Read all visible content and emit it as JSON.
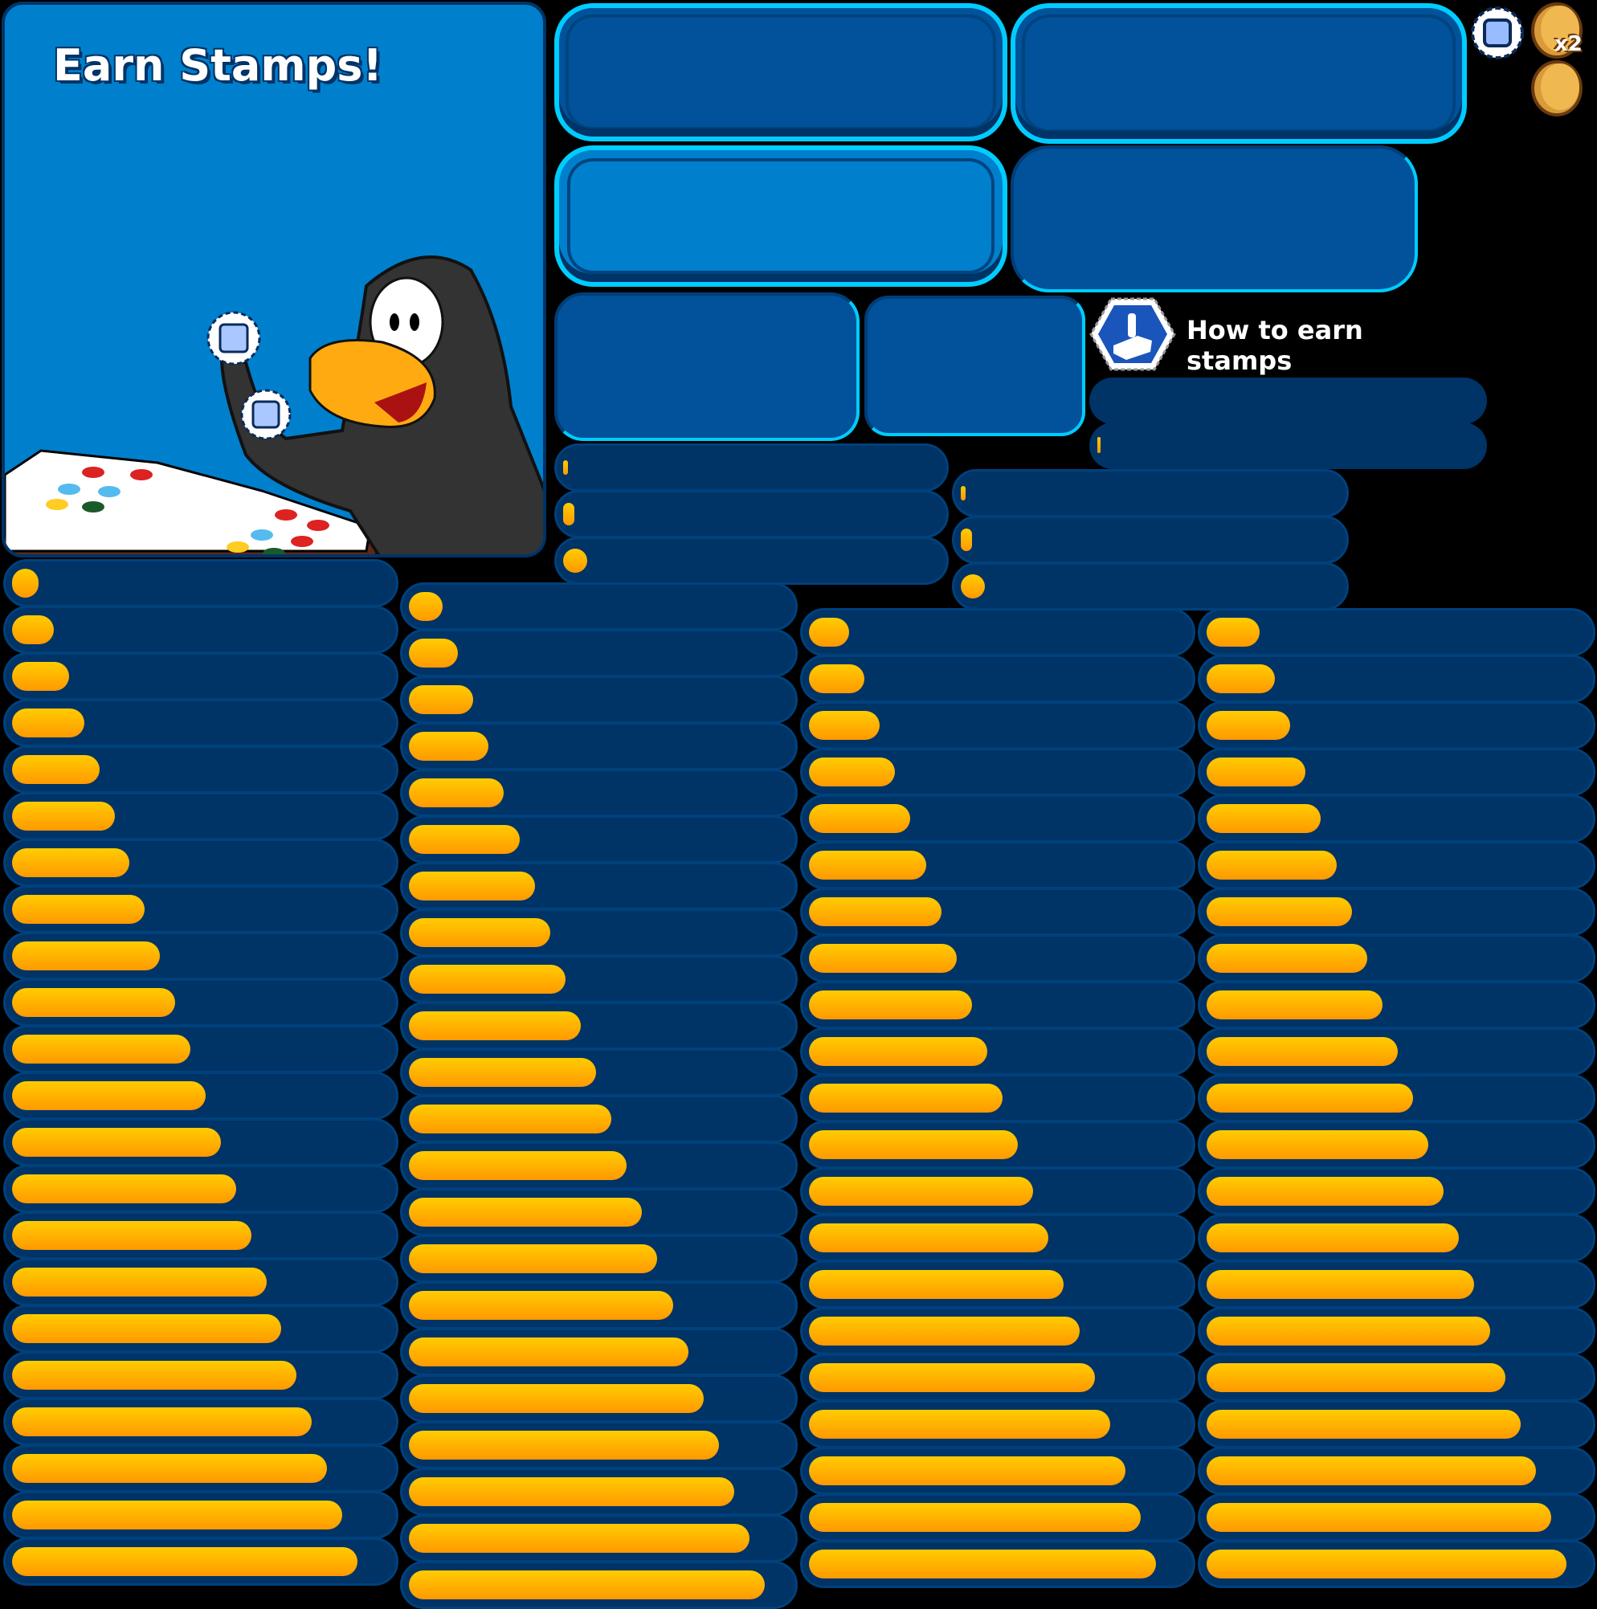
{
  "hero": {
    "title": "Earn Stamps!",
    "background_color": "#0080cc",
    "illustration": "penguin-holding-stamps-with-stamp-book"
  },
  "how_to_earn": {
    "label": "How to earn stamps",
    "icon": "joystick-stamp-icon"
  },
  "icons": {
    "stamp": "stamp-icon",
    "coin_x2_label": "x2",
    "coin": "coin-icon"
  },
  "colors": {
    "panel_dark": "#003366",
    "button_blue": "#01529a",
    "button_light": "#0080cc",
    "button_border": "#00ccff",
    "bar_top": "#ffcc00",
    "bar_bottom": "#ff9900"
  },
  "progress_strips": [
    {
      "frames": 3,
      "kind": "start"
    },
    {
      "frames": 3,
      "kind": "start"
    },
    {
      "frames": 22,
      "kind": "fill"
    },
    {
      "frames": 22,
      "kind": "fill"
    },
    {
      "frames": 21,
      "kind": "fill"
    },
    {
      "frames": 21,
      "kind": "fill"
    }
  ]
}
